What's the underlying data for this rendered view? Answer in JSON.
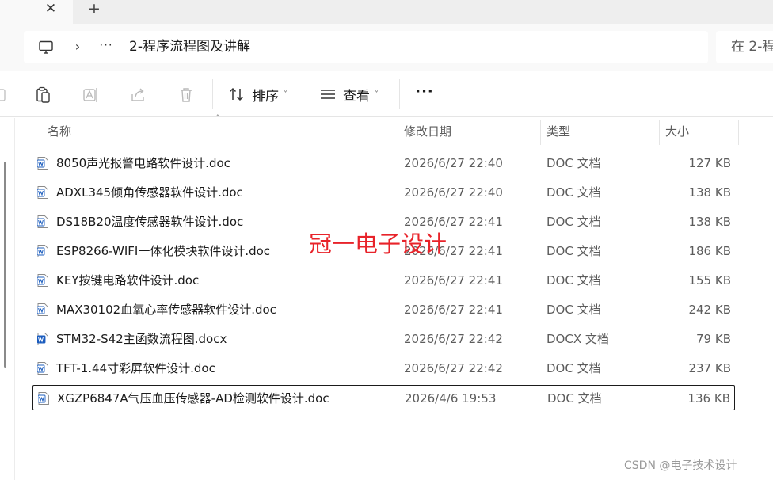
{
  "tabbar": {
    "close_icon": "close-icon",
    "new_tab_icon": "plus-icon",
    "close_glyph": "✕",
    "new_tab_glyph": "+"
  },
  "address": {
    "pc_icon": "computer-icon",
    "chevron_glyph": "›",
    "more_glyph": "···",
    "crumb": "2-程序流程图及讲解",
    "search_placeholder": "在 2-程"
  },
  "toolbar": {
    "sort_label": "排序",
    "view_label": "查看",
    "more_glyph": "···",
    "caret_glyph": "˅"
  },
  "columns": {
    "name": "名称",
    "date": "修改日期",
    "type": "类型",
    "size": "大小",
    "sort_glyph": "˄"
  },
  "files": [
    {
      "name": "8050声光报警电路软件设计.doc",
      "date": "2026/6/27 22:40",
      "type": "DOC 文档",
      "size": "127 KB",
      "icon": "word-doc-icon"
    },
    {
      "name": "ADXL345倾角传感器软件设计.doc",
      "date": "2026/6/27 22:40",
      "type": "DOC 文档",
      "size": "138 KB",
      "icon": "word-doc-icon"
    },
    {
      "name": "DS18B20温度传感器软件设计.doc",
      "date": "2026/6/27 22:41",
      "type": "DOC 文档",
      "size": "138 KB",
      "icon": "word-doc-icon"
    },
    {
      "name": "ESP8266-WIFI一体化模块软件设计.doc",
      "date": "2026/6/27 22:41",
      "type": "DOC 文档",
      "size": "186 KB",
      "icon": "word-doc-icon"
    },
    {
      "name": "KEY按键电路软件设计.doc",
      "date": "2026/6/27 22:41",
      "type": "DOC 文档",
      "size": "155 KB",
      "icon": "word-doc-icon"
    },
    {
      "name": "MAX30102血氧心率传感器软件设计.doc",
      "date": "2026/6/27 22:41",
      "type": "DOC 文档",
      "size": "242 KB",
      "icon": "word-doc-icon"
    },
    {
      "name": "STM32-S42主函数流程图.docx",
      "date": "2026/6/27 22:42",
      "type": "DOCX 文档",
      "size": "79 KB",
      "icon": "word-docx-icon"
    },
    {
      "name": "TFT-1.44寸彩屏软件设计.doc",
      "date": "2026/6/27 22:42",
      "type": "DOC 文档",
      "size": "237 KB",
      "icon": "word-doc-icon"
    },
    {
      "name": "XGZP6847A气压血压传感器-AD检测软件设计.doc",
      "date": "2026/4/6 19:53",
      "type": "DOC 文档",
      "size": "136 KB",
      "icon": "word-doc-icon",
      "selected": true
    }
  ],
  "overlay_text": "冠一电子设计",
  "watermark": "CSDN @电子技术设计",
  "colors": {
    "overlay": "#e8232a",
    "word_blue": "#1e5fbf",
    "docx_blue": "#185abd"
  }
}
